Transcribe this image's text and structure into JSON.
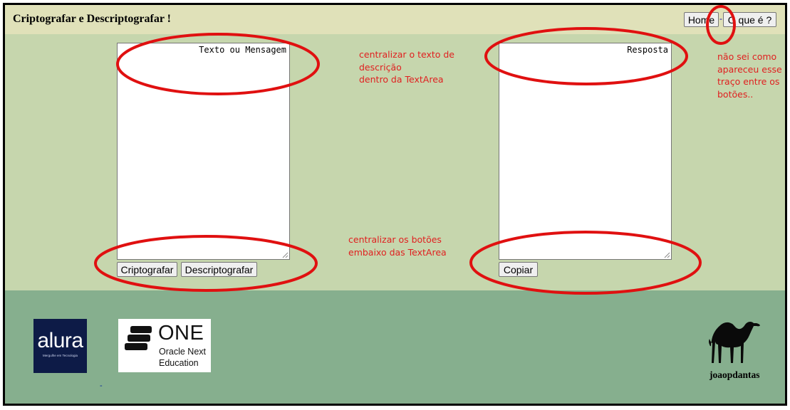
{
  "header": {
    "title": "Criptografar e Descriptografar !",
    "nav": {
      "home_label": "Home",
      "oque_label": "O que é ?",
      "separator": "-"
    }
  },
  "main": {
    "message_textarea": {
      "placeholder": "Texto ou Mensagem",
      "value": ""
    },
    "encrypt_label": "Criptografar",
    "decrypt_label": "Descriptografar",
    "response_textarea": {
      "placeholder": "Resposta",
      "value": ""
    },
    "copy_label": "Copiar"
  },
  "annotations": {
    "note_center_placeholder": "centralizar o texto de\ndescrição\ndentro da TextArea",
    "note_center_buttons": "centralizar os botões\nembaixo das TextArea",
    "note_dash": "não sei como\napareceu esse\ntraço entre os\nbotões..",
    "ink_color": "#e02020"
  },
  "footer": {
    "alura_logo": {
      "word": "alura",
      "tagline": "Mergulhe em Tecnologia",
      "bg_color": "#0d1b47"
    },
    "one_logo": {
      "word": "ONE",
      "line1": "Oracle Next",
      "line2": "Education"
    },
    "separator": "-",
    "camel_icon": "camel-icon",
    "author": "joaopdantas"
  },
  "colors": {
    "header_bg": "#e0e1b9",
    "main_bg": "#c6d6ad",
    "footer_bg": "#86af8e",
    "frame_border": "#000000"
  }
}
